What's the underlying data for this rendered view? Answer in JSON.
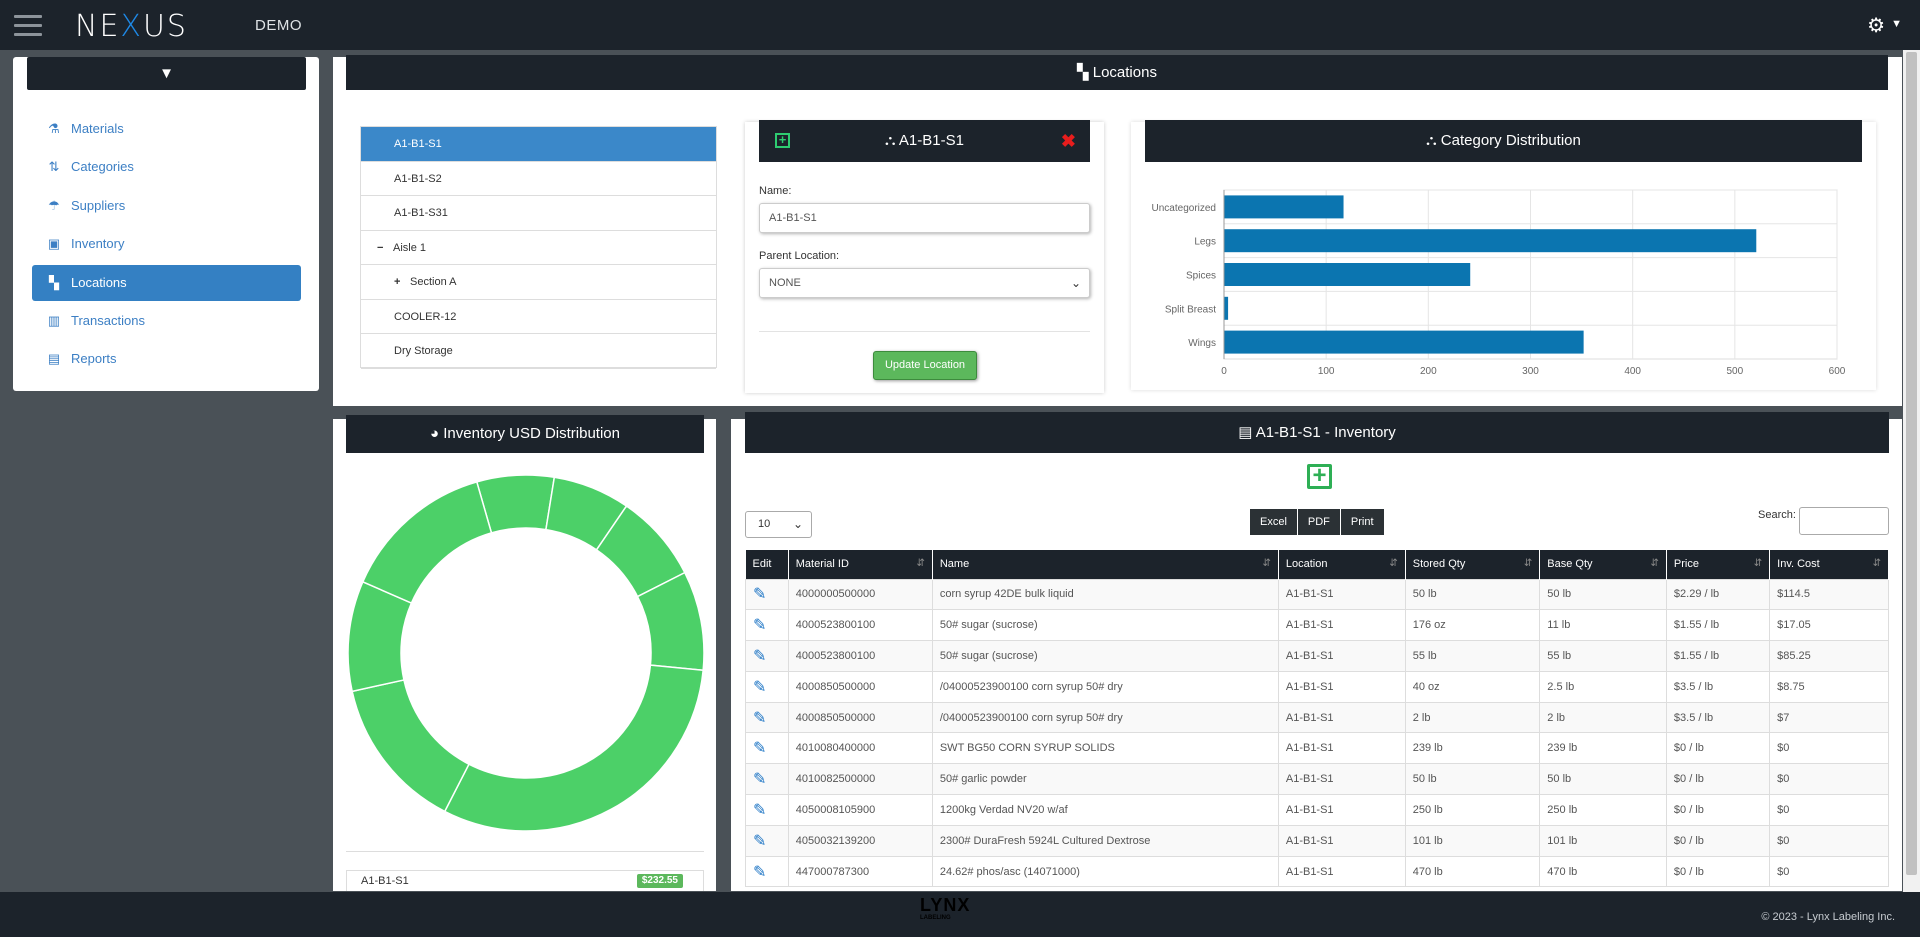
{
  "app": {
    "name": "NEXUS",
    "mode": "DEMO"
  },
  "header": {
    "menu_icon": "hamburger-icon",
    "settings_icon": "gear-icon"
  },
  "sidebar": {
    "filter_icon": "filter-icon",
    "items": [
      {
        "label": "Materials",
        "icon": "materials-icon",
        "active": false
      },
      {
        "label": "Categories",
        "icon": "categories-icon",
        "active": false
      },
      {
        "label": "Suppliers",
        "icon": "suppliers-icon",
        "active": false
      },
      {
        "label": "Inventory",
        "icon": "inventory-icon",
        "active": false
      },
      {
        "label": "Locations",
        "icon": "locations-icon",
        "active": true
      },
      {
        "label": "Transactions",
        "icon": "transactions-icon",
        "active": false
      },
      {
        "label": "Reports",
        "icon": "reports-icon",
        "active": false
      }
    ]
  },
  "locations": {
    "title": "Locations",
    "tree": [
      {
        "label": "A1-B1-S1",
        "active": true
      },
      {
        "label": "A1-B1-S2"
      },
      {
        "label": "A1-B1-S31"
      },
      {
        "label": "Aisle 1",
        "symbol": "−"
      },
      {
        "label": "Section A",
        "symbol": "+"
      },
      {
        "label": "COOLER-12"
      },
      {
        "label": "Dry Storage"
      }
    ]
  },
  "editor": {
    "title": "A1-B1-S1",
    "name_label": "Name:",
    "name_value": "A1-B1-S1",
    "parent_label": "Parent Location:",
    "parent_value": "NONE",
    "update_label": "Update Location"
  },
  "category": {
    "title": "Category Distribution"
  },
  "chart_data": {
    "type": "bar",
    "orientation": "horizontal",
    "categories": [
      "Uncategorized",
      "Legs",
      "Spices",
      "Split Breast",
      "Wings"
    ],
    "values": [
      117,
      521,
      241,
      4,
      352
    ],
    "xlim": [
      0,
      600
    ],
    "xticks": [
      "0",
      "100",
      "200",
      "300",
      "400",
      "500",
      "600"
    ],
    "color": "#0b75b0",
    "grid": true
  },
  "donut": {
    "title": "Inventory USD Distribution",
    "color": "#4cd068",
    "segments": [
      7,
      7,
      8,
      9,
      31,
      14,
      10,
      14
    ],
    "legend_label": "A1-B1-S1",
    "legend_value": "$232.55"
  },
  "inventory": {
    "title": "A1-B1-S1 - Inventory",
    "page_len": "10",
    "buttons": [
      "Excel",
      "PDF",
      "Print"
    ],
    "search_label": "Search:",
    "columns": [
      "Edit",
      "Material ID",
      "Name",
      "Location",
      "Stored Qty",
      "Base Qty",
      "Price",
      "Inv. Cost"
    ],
    "rows": [
      [
        "4000000500000",
        "corn syrup 42DE bulk liquid",
        "A1-B1-S1",
        "50 lb",
        "50 lb",
        "$2.29 / lb",
        "$114.5"
      ],
      [
        "4000523800100",
        "50# sugar (sucrose)",
        "A1-B1-S1",
        "176 oz",
        "11 lb",
        "$1.55 / lb",
        "$17.05"
      ],
      [
        "4000523800100",
        "50# sugar (sucrose)",
        "A1-B1-S1",
        "55 lb",
        "55 lb",
        "$1.55 / lb",
        "$85.25"
      ],
      [
        "4000850500000",
        "/04000523900100 corn syrup 50# dry",
        "A1-B1-S1",
        "40 oz",
        "2.5 lb",
        "$3.5 / lb",
        "$8.75"
      ],
      [
        "4000850500000",
        "/04000523900100 corn syrup 50# dry",
        "A1-B1-S1",
        "2 lb",
        "2 lb",
        "$3.5 / lb",
        "$7"
      ],
      [
        "4010080400000",
        "SWT BG50 CORN SYRUP SOLIDS",
        "A1-B1-S1",
        "239 lb",
        "239 lb",
        "$0 / lb",
        "$0"
      ],
      [
        "4010082500000",
        "50# garlic powder",
        "A1-B1-S1",
        "50 lb",
        "50 lb",
        "$0 / lb",
        "$0"
      ],
      [
        "4050008105900",
        "1200kg Verdad NV20 w/af",
        "A1-B1-S1",
        "250 lb",
        "250 lb",
        "$0 / lb",
        "$0"
      ],
      [
        "4050032139200",
        "2300# DuraFresh 5924L Cultured Dextrose",
        "A1-B1-S1",
        "101 lb",
        "101 lb",
        "$0 / lb",
        "$0"
      ],
      [
        "447000787300",
        "24.62# phos/asc (14071000)",
        "A1-B1-S1",
        "470 lb",
        "470 lb",
        "$0 / lb",
        "$0"
      ]
    ]
  },
  "footer": {
    "brand": "LYNX",
    "brand_sub": "LABELING",
    "copyright": "© 2023 - Lynx Labeling Inc."
  }
}
